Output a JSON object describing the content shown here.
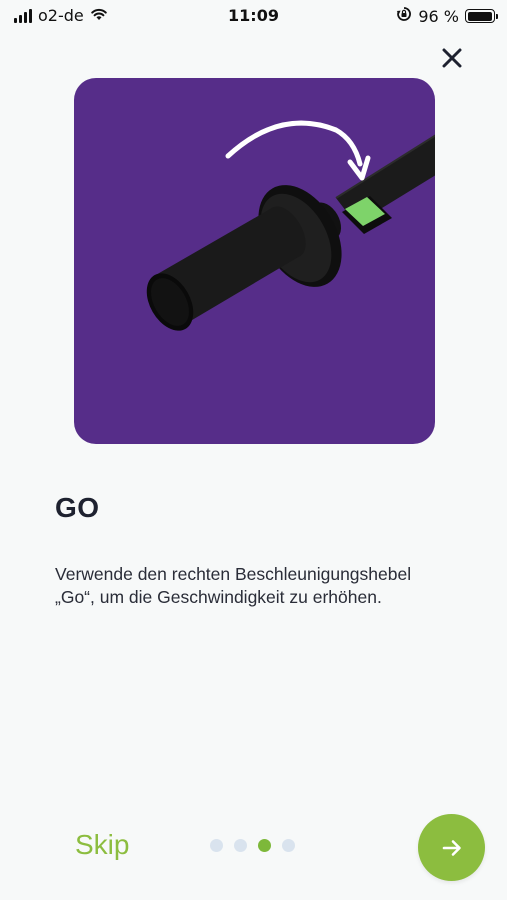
{
  "status_bar": {
    "carrier": "o2-de",
    "time": "11:09",
    "battery_percent": "96 %",
    "battery_level": 0.96
  },
  "onboarding": {
    "title": "GO",
    "description": "Verwende den rechten Beschleunigungshebel „Go“, um die Geschwindigkeit zu erhöhen.",
    "skip_label": "Skip",
    "page_index": 3,
    "page_count": 4
  },
  "colors": {
    "illustration_background": "#562d89",
    "accent_green": "#8cbd3f",
    "throttle_marker": "#7ed36a",
    "dot_inactive": "#d9e3ee"
  },
  "icons": {
    "close": "close-icon",
    "next": "arrow-right-icon",
    "wifi": "wifi-icon",
    "rotation_lock": "rotation-lock-icon"
  }
}
